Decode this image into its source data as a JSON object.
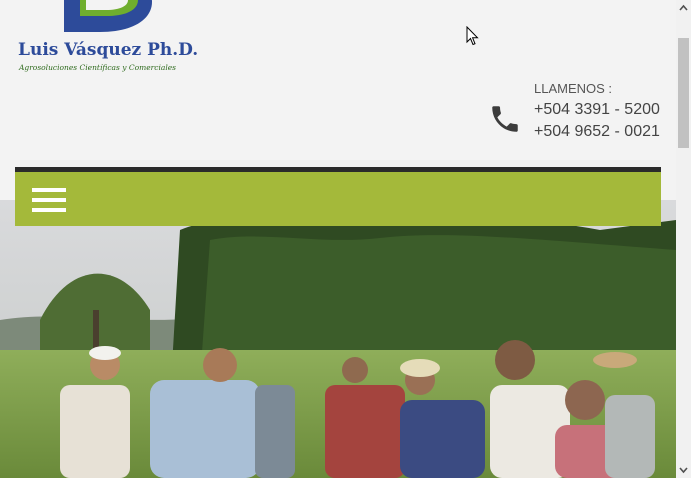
{
  "logo": {
    "name": "Luis Vásquez Ph.D.",
    "tagline": "Agrosoluciones Científicas y Comerciales"
  },
  "contact": {
    "label": "LLAMENOS :",
    "phones": [
      "+504 3391 - 5200",
      "+504 9652 - 0021"
    ]
  },
  "nav": {
    "menu_icon": "hamburger-menu-icon"
  },
  "colors": {
    "brand_blue": "#2d4b9a",
    "brand_green": "#a4b93a",
    "nav_border": "#2b2b2b"
  },
  "hero": {
    "description_icon": "field-photo"
  }
}
